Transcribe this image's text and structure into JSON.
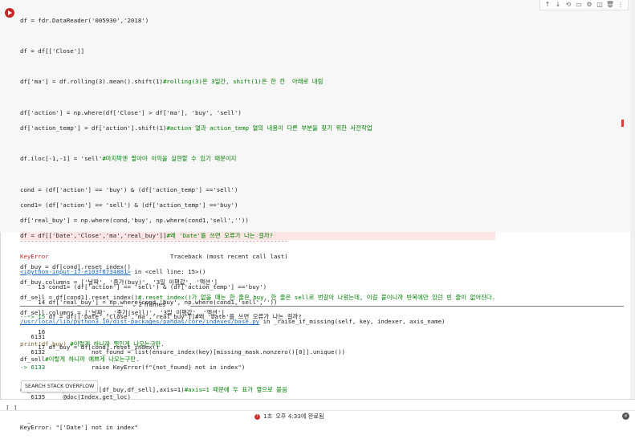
{
  "toolbar": {
    "icons": [
      "arrow-up-icon",
      "arrow-down-icon",
      "link-icon",
      "comment-icon",
      "gear-icon",
      "mirror-icon",
      "trash-icon",
      "more-icon"
    ],
    "glyphs": [
      "↑",
      "↓",
      "⟲",
      "▭",
      "⚙",
      "◫",
      "🗑",
      "⋮"
    ]
  },
  "code": {
    "l1": "df = fdr.DataReader('005930','2018')",
    "l2": "df = df[['Close']]",
    "l3a": "df['ma'] = df.rolling(3).mean().shift(1)",
    "l3c": "#rolling(3)은 3일간, shift(1)은 한 칸  아래로 내림",
    "l4": "df['action'] = np.where(df['Close'] > df['ma'], 'buy', 'sell')",
    "l5a": "df['action_temp'] = df['action'].shift(1)",
    "l5c": "#action 열과 action_temp 열의 내용이 다른 부분을 찾기 위한 사전작업",
    "l6a": "df.iloc[-1,-1] = 'sell'",
    "l6c": "#마지막엔 팔아야 이익을 실현할 수 있기 때문이지",
    "l7": "cond = (df['action'] == 'buy') & (df['action_temp'] =='sell')",
    "l8": "cond1= (df['action'] == 'sell') & (df['action_temp'] =='buy')",
    "l9": "df['real_buy'] = np.where(cond,'buy', np.where(cond1,'sell',''))",
    "l10a": "df = df[[",
    "l10b": "'Date','Close','ma','real_buy']]",
    "l10c": "#왜 'Date'를 쓰면 오류가 나는 걸까?",
    "l11": "df_buy = df[cond].reset_index()",
    "l12": "df_buy.columns = ['날짜', '종가(buy)', '3일 이평값', '액션']",
    "l13a": "df_sell = df[cond1].reset_index()",
    "l13c": "#.reset_index()가 없을 때는 한 줄은 buy, 한 줄은 sell로 번갈아 나왔는데, 이걸 붙이니까 반복에만 있던 빈 줄이 없어진다.",
    "l14": "df_sell.columns = ['날짜', '종가(sell)', '3일 이평값', '액션']",
    "l15a": "print(df_buy)",
    "l15c": " #이렇게 하니까 뭣인게 나오는구만.",
    "l16a": "df_sell",
    "l16c": "#이렇게 하니까 예쁘게 나오는구만.",
    "l17a": "df_result = pd.concat([df_buy,df_sell],axis=1)",
    "l17c": "#axis=1 때문에 두 표가 옆으로 붙음",
    "l18": "df_result"
  },
  "output": {
    "dashes": "---------------------------------------------------------------------------",
    "error_name": "KeyError",
    "traceback_label": "Traceback (most recent call last)",
    "input_link": "<ipython-input-17-e103f6734881>",
    "input_loc": " in <cell line: 15>()",
    "t13": "     13 cond1= (df['action'] == 'sell') & (df['action_temp'] =='buy')",
    "t14": "     14 df['real_buy'] = np.where(cond,'buy', np.where(cond1,'sell',''))",
    "t15arrow": "---> 15",
    "t15": " df = df[['Date','Close','ma','real_buy']]#왜 'Date'를 쓰면 오류가 나는 걸까?",
    "t16": "     16",
    "t17": "     17 df_buy = df[cond].reset_index()",
    "frames_label": "2 frames",
    "base_link": "/usr/local/lib/python3.10/dist-packages/pandas/core/indexes/base.py",
    "base_loc": " in _raise_if_missing(self, key, indexer, axis_name)",
    "f6131": "   6131",
    "f6132": "   6132             not_found = list(ensure_index(key)[missing_mask.nonzero()[0]].unique())",
    "f6133arrow": "-> 6133",
    "f6133": "             raise KeyError(f\"{not_found} not in index\")",
    "f6134": "   6134",
    "f6135": "   6135     @doc(Index.get_loc)",
    "final_error": "KeyError: \"['Date'] not in index\"",
    "so_button": "SEARCH STACK OVERFLOW"
  },
  "footer": {
    "bracket": "[ ]",
    "status_seconds": "1초",
    "status_time": "오후 4:33에 완료됨"
  }
}
